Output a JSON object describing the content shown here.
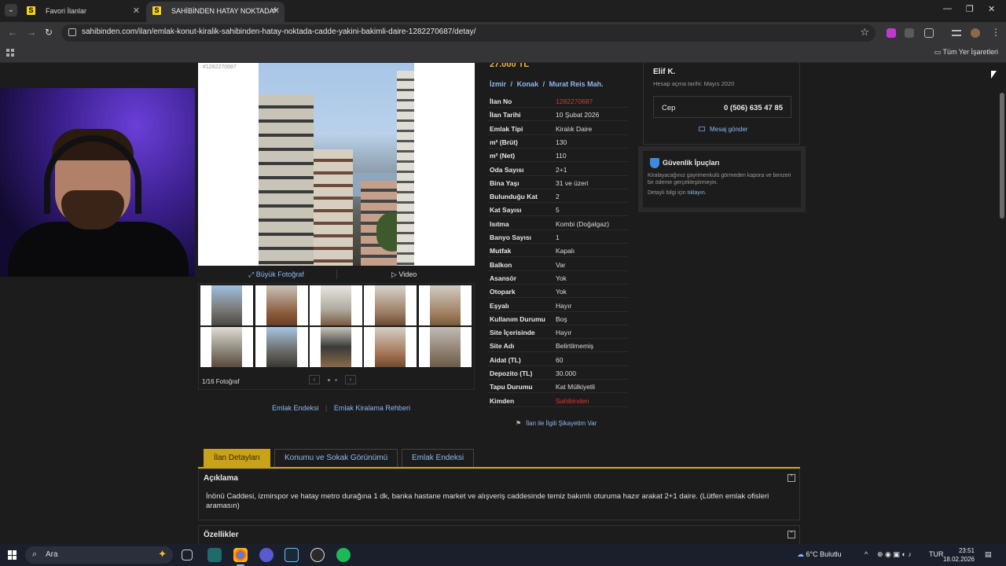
{
  "browser": {
    "tabs": [
      {
        "title": "Favori İlanlar",
        "favicon": "S"
      },
      {
        "title": "SAHİBİNDEN HATAY NOKTADA",
        "favicon": "S"
      }
    ],
    "url": "sahibinden.com/ilan/emlak-konut-kiralik-sahibinden-hatay-noktada-cadde-yakini-bakimli-daire-1282270687/detay/",
    "bookmarks_all": "Tüm Yer İşaretleri"
  },
  "listing": {
    "ad_id_tag": "#1282270687",
    "price": "27.000 TL",
    "location": {
      "city": "İzmir",
      "district": "Konak",
      "neighborhood": "Murat Reis Mah.",
      "sep": "/"
    },
    "gallery": {
      "big_photo_label": "Büyük Fotoğraf",
      "video_label": "Video",
      "photo_count": "1/16 Fotoğraf"
    },
    "details": [
      {
        "k": "İlan No",
        "v": "1282270687",
        "red": true
      },
      {
        "k": "İlan Tarihi",
        "v": "10 Şubat 2026"
      },
      {
        "k": "Emlak Tipi",
        "v": "Kiralık Daire"
      },
      {
        "k": "m² (Brüt)",
        "v": "130"
      },
      {
        "k": "m² (Net)",
        "v": "110"
      },
      {
        "k": "Oda Sayısı",
        "v": "2+1"
      },
      {
        "k": "Bina Yaşı",
        "v": "31 ve üzeri"
      },
      {
        "k": "Bulunduğu Kat",
        "v": "2"
      },
      {
        "k": "Kat Sayısı",
        "v": "5"
      },
      {
        "k": "Isıtma",
        "v": "Kombi (Doğalgaz)"
      },
      {
        "k": "Banyo Sayısı",
        "v": "1"
      },
      {
        "k": "Mutfak",
        "v": "Kapalı"
      },
      {
        "k": "Balkon",
        "v": "Var"
      },
      {
        "k": "Asansör",
        "v": "Yok"
      },
      {
        "k": "Otopark",
        "v": "Yok"
      },
      {
        "k": "Eşyalı",
        "v": "Hayır"
      },
      {
        "k": "Kullanım Durumu",
        "v": "Boş"
      },
      {
        "k": "Site İçerisinde",
        "v": "Hayır"
      },
      {
        "k": "Site Adı",
        "v": "Belirtilmemiş"
      },
      {
        "k": "Aidat (TL)",
        "v": "60"
      },
      {
        "k": "Depozito (TL)",
        "v": "30.000"
      },
      {
        "k": "Tapu Durumu",
        "v": "Kat Mülkiyetli"
      },
      {
        "k": "Kimden",
        "v": "Sahibinden",
        "red": true
      }
    ],
    "complaint": "İlan ile İlgili Şikayetim Var",
    "guides": {
      "index": "Emlak Endeksi",
      "sep": "|",
      "rent_guide": "Emlak Kiralama Rehberi"
    }
  },
  "seller": {
    "name": "Elif K.",
    "since": "Hesap açma tarihi: Mayıs 2020",
    "phone_label": "Cep",
    "phone": "0 (506) 635 47 85",
    "message": "Mesaj gönder"
  },
  "security": {
    "title": "Güvenlik İpuçları",
    "text": "Kiralayacağınız gayrimenkulü görmeden kapora ve benzeri bir ödeme gerçekleştirmeyin.",
    "more_prefix": "Detaylı bilgi için",
    "more_link": "tıklayın."
  },
  "tabs": [
    {
      "label": "İlan Detayları",
      "active": true
    },
    {
      "label": "Konumu ve Sokak Görünümü"
    },
    {
      "label": "Emlak Endeksi"
    }
  ],
  "sections": {
    "description_header": "Açıklama",
    "description": "İnönü Caddesi, izmirspor ve hatay metro durağına 1 dk, banka hastane market ve alışveriş caddesinde temiz bakımlı oturuma hazır arakat 2+1 daire. (Lütfen emlak ofisleri aramasın)",
    "features_header": "Özellikler"
  },
  "taskbar": {
    "search_placeholder": "Ara",
    "weather": "6°C Bulutlu",
    "lang": "TUR",
    "time": "23:51",
    "date": "18.02.2026"
  },
  "colors": {
    "accent": "#c9a21b",
    "link": "#8fb8f0",
    "price": "#f2b634",
    "red": "#e0342e"
  }
}
